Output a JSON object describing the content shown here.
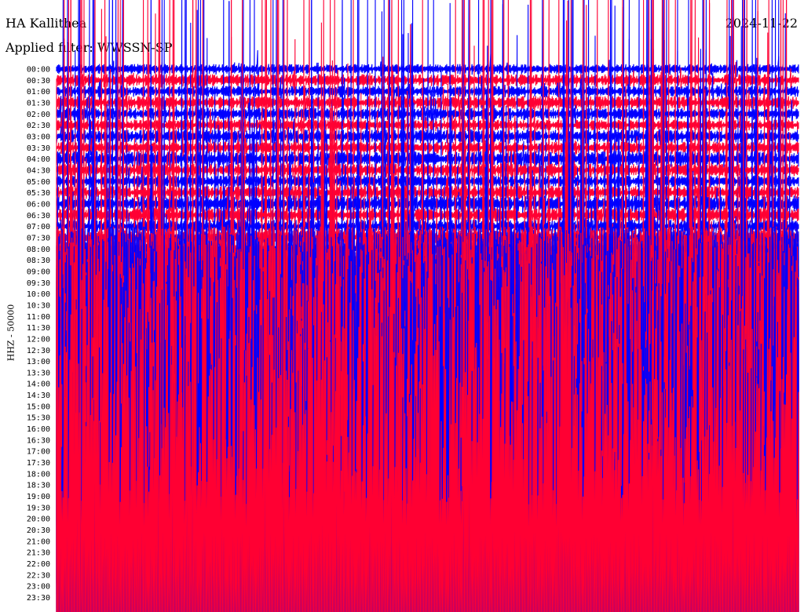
{
  "header": {
    "station": "HA Kallithea",
    "date": "2024-11-22",
    "filter": "Applied filter: WWSSN-SP"
  },
  "colors": {
    "trace_a": "#0000ff",
    "trace_b": "#ff0033",
    "background": "#ffffff"
  },
  "chart_data": {
    "type": "line",
    "title": "HA Kallithea",
    "ylabel": "HHZ - 50000",
    "time_labels": [
      "00:00",
      "00:30",
      "01:00",
      "01:30",
      "02:00",
      "02:30",
      "03:00",
      "03:30",
      "04:00",
      "04:30",
      "05:00",
      "05:30",
      "06:00",
      "06:30",
      "07:00",
      "07:30",
      "08:00",
      "08:30",
      "09:00",
      "09:30",
      "10:00",
      "10:30",
      "11:00",
      "11:30",
      "12:00",
      "12:30",
      "13:00",
      "13:30",
      "14:00",
      "14:30",
      "15:00",
      "15:30",
      "16:00",
      "16:30",
      "17:00",
      "17:30",
      "18:00",
      "18:30",
      "19:00",
      "19:30",
      "20:00",
      "20:30",
      "21:00",
      "21:30",
      "22:00",
      "22:30",
      "23:00",
      "23:30"
    ],
    "trace_colors": [
      "#0000ff",
      "#ff0033"
    ],
    "row_amplitude": [
      0.45,
      0.55,
      0.5,
      0.6,
      0.55,
      0.5,
      0.6,
      0.55,
      0.7,
      0.6,
      0.55,
      0.6,
      0.75,
      0.65,
      0.6,
      0.7,
      0.55,
      0.5,
      0.55,
      0.6,
      6,
      7,
      8,
      9,
      10,
      11,
      12,
      13,
      14,
      15,
      16,
      17,
      18,
      19,
      20,
      21,
      22,
      23,
      24,
      25,
      26,
      27,
      28,
      29,
      30,
      31,
      32,
      33
    ]
  }
}
